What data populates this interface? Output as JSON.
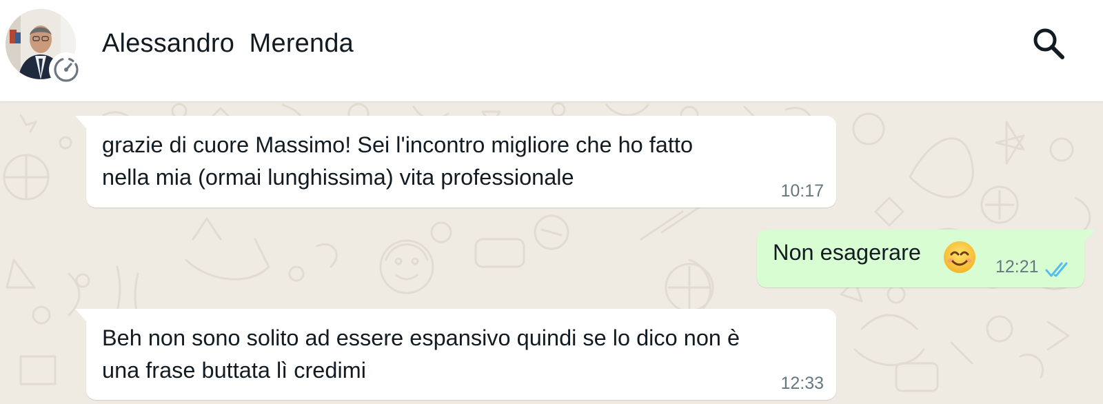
{
  "header": {
    "contact_name": "Alessandro  Merenda",
    "avatar_icon": "contact-avatar",
    "status_icon": "status-ring-icon",
    "search_icon": "search-icon"
  },
  "messages": [
    {
      "direction": "incoming",
      "text": "grazie di cuore Massimo! Sei l'incontro migliore che ho fatto\nnella mia (ormai lunghissima) vita professionale",
      "time": "10:17"
    },
    {
      "direction": "outgoing",
      "text": "Non esagerare",
      "emoji": "smiling-face-icon",
      "time": "12:21",
      "status": "read",
      "status_icon": "double-check-icon"
    },
    {
      "direction": "incoming",
      "text": "Beh non sono solito ad essere espansivo quindi se lo dico non è\nuna frase buttata lì credimi",
      "time": "12:33"
    }
  ],
  "colors": {
    "header_bg": "#ffffff",
    "chat_bg": "#efeae2",
    "incoming_bubble": "#ffffff",
    "outgoing_bubble": "#d9fdd3",
    "read_ticks": "#53bdeb",
    "text": "#111b21",
    "timestamp": "#667781"
  }
}
